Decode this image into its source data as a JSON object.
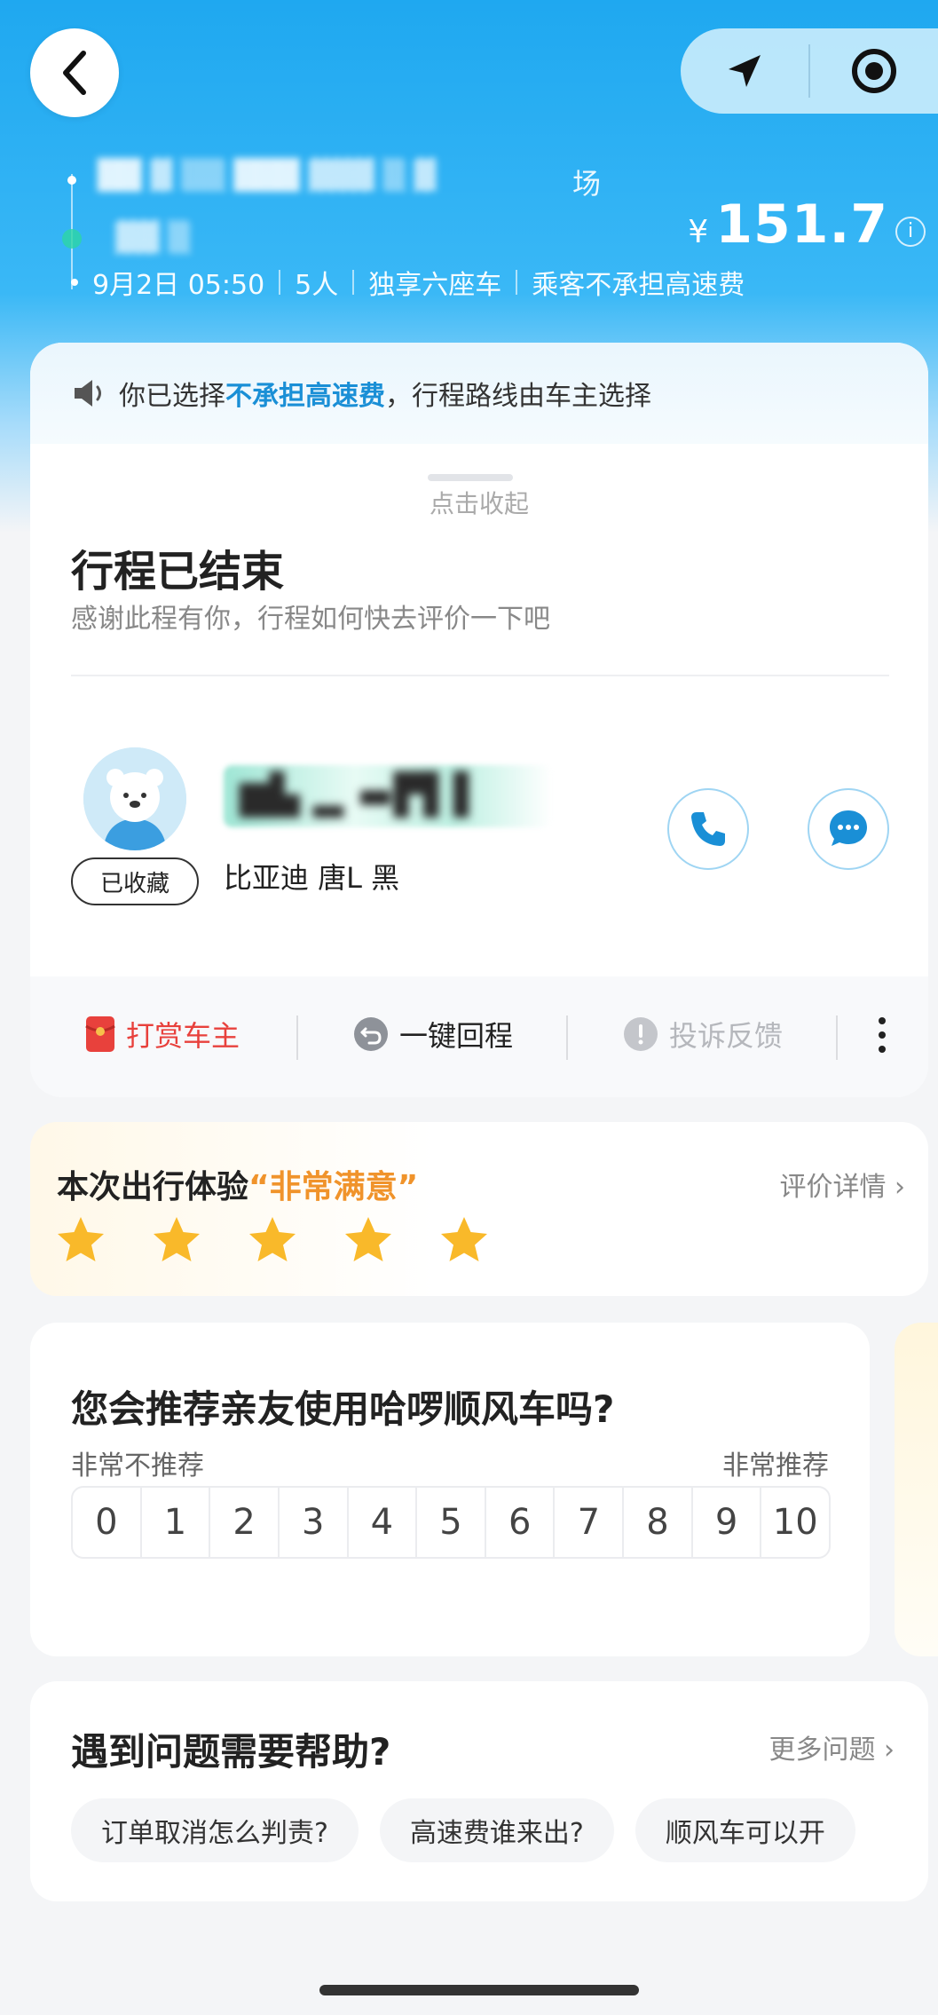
{
  "header": {
    "price_currency": "¥",
    "price_amount": "151.7",
    "price_info_icon": "i",
    "origin_tail": "场",
    "meta": {
      "datetime": "9月2日 05:50",
      "passengers": "5人",
      "car_type": "独享六座车",
      "toll_policy": "乘客不承担高速费"
    },
    "icons": {
      "back": "back-arrow-icon",
      "navigate": "navigation-arrow-icon",
      "locate": "locate-target-icon"
    }
  },
  "notice": {
    "prefix": "你已选择",
    "highlight": "不承担高速费",
    "suffix": "，行程路线由车主选择",
    "highlight_color": "#1a8fd6"
  },
  "trip": {
    "collapse_label": "点击收起",
    "status_title": "行程已结束",
    "status_sub": "感谢此程有你，行程如何快去评价一下吧"
  },
  "driver": {
    "favorite_label": "已收藏",
    "car_info": "比亚迪 唐L 黑"
  },
  "actions": {
    "tip": "打赏车主",
    "return_trip": "一键回程",
    "complaint": "投诉反馈",
    "tip_color": "#e8413c"
  },
  "experience": {
    "title_prefix": "本次出行体验",
    "rating_text": "“非常满意”",
    "details_link": "评价详情",
    "stars": 5
  },
  "nps": {
    "question": "您会推荐亲友使用哈啰顺风车吗?",
    "low_label": "非常不推荐",
    "high_label": "非常推荐",
    "scale": [
      "0",
      "1",
      "2",
      "3",
      "4",
      "5",
      "6",
      "7",
      "8",
      "9",
      "10"
    ]
  },
  "help": {
    "title": "遇到问题需要帮助?",
    "more_link": "更多问题",
    "chips": [
      "订单取消怎么判责?",
      "高速费谁来出?",
      "顺风车可以开"
    ]
  }
}
